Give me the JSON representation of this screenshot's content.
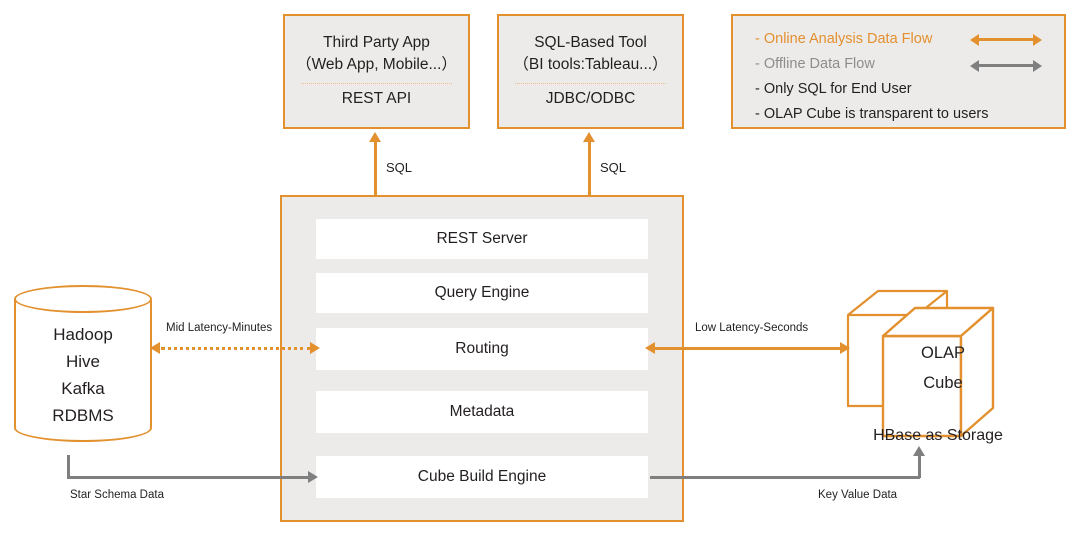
{
  "clients": [
    {
      "id": "third-party-app",
      "title_line1": "Third Party App",
      "title_line2": "（Web App, Mobile...）",
      "api": "REST API",
      "protocol_label": "SQL"
    },
    {
      "id": "sql-based-tool",
      "title_line1": "SQL-Based Tool",
      "title_line2": "（BI tools:Tableau...）",
      "api": "JDBC/ODBC",
      "protocol_label": "SQL"
    }
  ],
  "legend": {
    "items": [
      {
        "label": "- Online Analysis Data Flow",
        "style": "orange",
        "arrow": "orange-double-arrow"
      },
      {
        "label": "- Offline Data Flow",
        "style": "gray",
        "arrow": "gray-double-arrow"
      },
      {
        "label": "- Only SQL for End User",
        "style": "dark",
        "arrow": null
      },
      {
        "label": "- OLAP Cube is transparent to users",
        "style": "dark",
        "arrow": null
      }
    ]
  },
  "panel": {
    "rows": [
      {
        "label": "REST Server"
      },
      {
        "label": "Query Engine"
      },
      {
        "label": "Routing"
      },
      {
        "label": "Metadata"
      },
      {
        "label": "Cube Build Engine"
      }
    ]
  },
  "source_store": {
    "name": "source-datastore-cylinder",
    "lines": [
      "Hadoop",
      "Hive",
      "Kafka",
      "RDBMS"
    ]
  },
  "cube_store": {
    "name": "olap-cube",
    "lines": [
      "OLAP",
      "Cube"
    ],
    "storage_label": "HBase  as Storage"
  },
  "connectors": {
    "mid_latency": "Mid Latency-Minutes",
    "low_latency": "Low Latency-Seconds",
    "star_schema": "Star Schema Data",
    "key_value": "Key Value Data"
  },
  "colors": {
    "orange": "#E3902F",
    "gray": "#7f7f7f",
    "panel_fill": "#EDEBEA",
    "row_fill": "#FFFFFF",
    "text": "#231f20",
    "divider": "#EBBE8C"
  }
}
